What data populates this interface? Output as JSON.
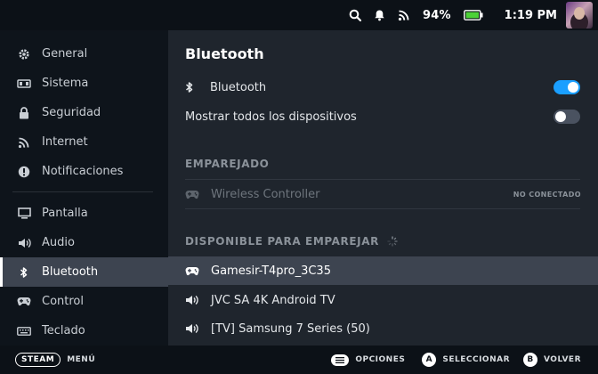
{
  "status": {
    "battery_pct": "94%",
    "time": "1:19 PM",
    "battery_color": "#4cd137"
  },
  "sidebar": {
    "items": [
      {
        "label": "General",
        "icon": "gear-icon"
      },
      {
        "label": "Sistema",
        "icon": "system-icon"
      },
      {
        "label": "Seguridad",
        "icon": "lock-icon"
      },
      {
        "label": "Internet",
        "icon": "wifi-icon"
      },
      {
        "label": "Notificaciones",
        "icon": "alert-icon"
      },
      {
        "label": "Pantalla",
        "icon": "display-icon"
      },
      {
        "label": "Audio",
        "icon": "speaker-icon"
      },
      {
        "label": "Bluetooth",
        "icon": "bluetooth-icon"
      },
      {
        "label": "Control",
        "icon": "gamepad-icon"
      },
      {
        "label": "Teclado",
        "icon": "keyboard-icon"
      }
    ],
    "active": "Bluetooth"
  },
  "main": {
    "title": "Bluetooth",
    "bluetooth_toggle": {
      "label": "Bluetooth",
      "on": true
    },
    "show_all_toggle": {
      "label": "Mostrar todos los dispositivos",
      "on": false
    },
    "paired_heading": "EMPAREJADO",
    "paired": [
      {
        "name": "Wireless Controller",
        "status": "NO CONECTADO",
        "icon": "gamepad-icon"
      }
    ],
    "available_heading": "DISPONIBLE PARA EMPAREJAR",
    "available": [
      {
        "name": "Gamesir-T4pro_3C35",
        "icon": "gamepad-icon"
      },
      {
        "name": "JVC SA 4K Android TV",
        "icon": "speaker-icon"
      },
      {
        "name": "[TV] Samsung 7 Series (50)",
        "icon": "speaker-icon"
      }
    ]
  },
  "footer": {
    "steam_label": "STEAM",
    "menu_label": "MENÚ",
    "options_label": "OPCIONES",
    "select_key": "A",
    "select_label": "SELECCIONAR",
    "back_key": "B",
    "back_label": "VOLVER"
  },
  "colors": {
    "accent": "#1a9fff",
    "selected_bg": "#3d4450",
    "panel_bg": "#1f252d",
    "sidebar_bg": "#0e141b"
  }
}
